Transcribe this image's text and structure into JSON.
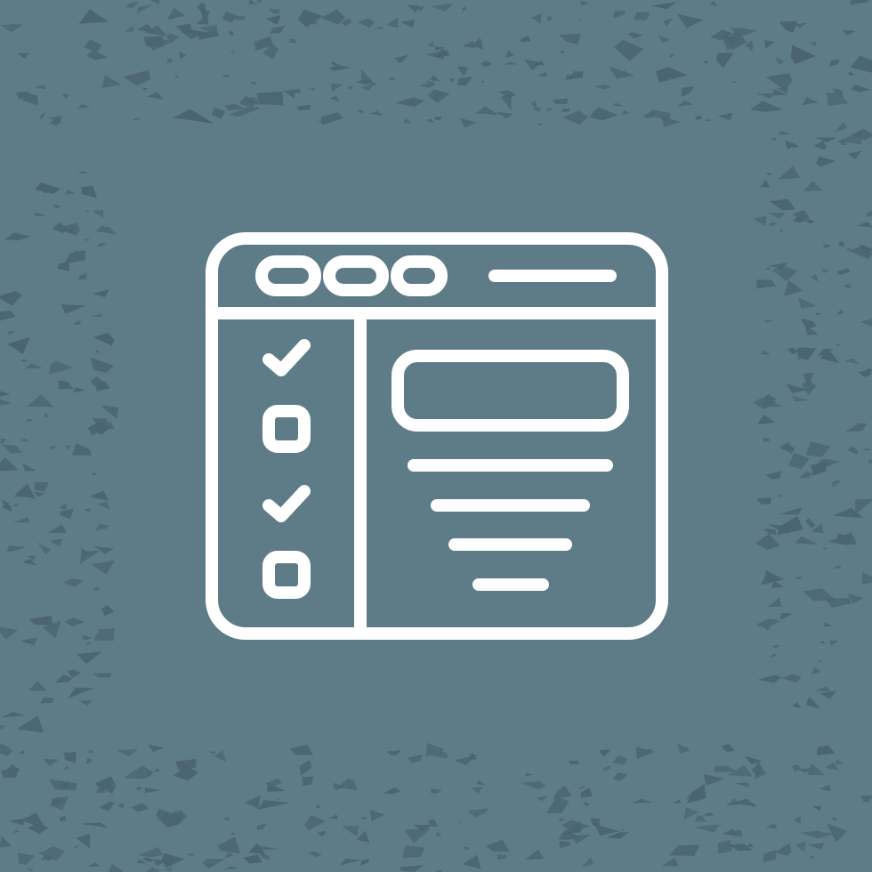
{
  "colors": {
    "background": "#5e7b88",
    "texture": "#4a6472",
    "stroke": "#ffffff"
  },
  "icon": {
    "name": "browser-checklist-icon",
    "window_dots": 3,
    "checklist": [
      {
        "state": "checked"
      },
      {
        "state": "unchecked"
      },
      {
        "state": "checked"
      },
      {
        "state": "unchecked"
      }
    ],
    "content_text_lines": 4
  }
}
